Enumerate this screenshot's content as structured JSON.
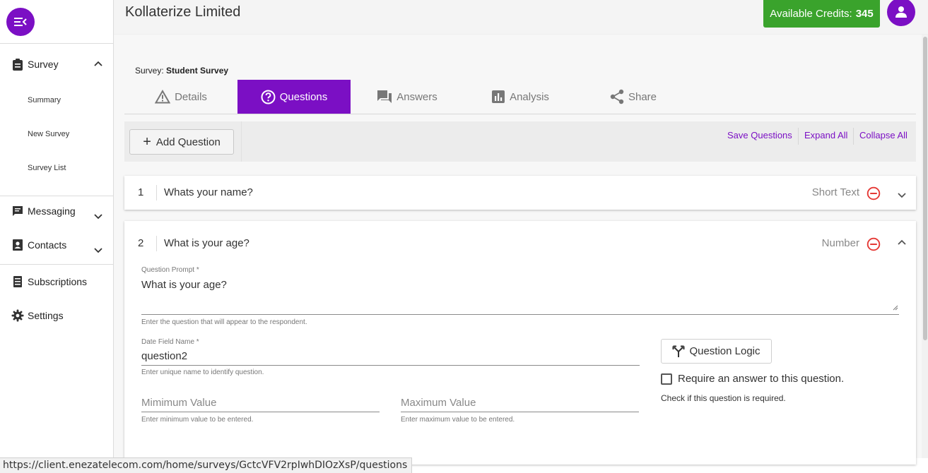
{
  "sidebar": {
    "menu_icon": "menu-collapse-icon",
    "items": [
      {
        "label": "Survey",
        "icon": "clipboard-icon",
        "expanded": true
      },
      {
        "label": "Messaging",
        "icon": "chat-icon",
        "expanded": false
      },
      {
        "label": "Contacts",
        "icon": "contacts-icon",
        "expanded": false
      },
      {
        "label": "Subscriptions",
        "icon": "list-icon"
      },
      {
        "label": "Settings",
        "icon": "gear-icon"
      }
    ],
    "survey_sub": [
      "Summary",
      "New Survey",
      "Survey List"
    ]
  },
  "header": {
    "company": "Kollaterize Limited",
    "credits_label": "Available Credits:",
    "credits_value": "345"
  },
  "survey": {
    "prefix": "Survey:",
    "name": "Student Survey"
  },
  "tabs": [
    {
      "label": "Details",
      "icon": "warning-triangle-icon",
      "active": false
    },
    {
      "label": "Questions",
      "icon": "question-circle-icon",
      "active": true
    },
    {
      "label": "Answers",
      "icon": "forum-icon",
      "active": false
    },
    {
      "label": "Analysis",
      "icon": "bar-chart-icon",
      "active": false
    },
    {
      "label": "Share",
      "icon": "share-icon",
      "active": false
    }
  ],
  "toolbar": {
    "add_question": "Add Question",
    "save_questions": "Save Questions",
    "expand_all": "Expand All",
    "collapse_all": "Collapse All"
  },
  "questions": [
    {
      "number": "1",
      "title": "Whats your name?",
      "type": "Short Text",
      "expanded": false
    },
    {
      "number": "2",
      "title": "What is your age?",
      "type": "Number",
      "expanded": true,
      "prompt_label": "Question Prompt *",
      "prompt_value": "What is your age?",
      "prompt_help": "Enter the question that will appear to the respondent.",
      "field_label": "Date Field Name *",
      "field_value": "question2",
      "field_help": "Enter unique name to identify question.",
      "min_placeholder": "Mimimum Value",
      "min_help": "Enter minimum value to be entered.",
      "max_placeholder": "Maximum Value",
      "max_help": "Enter maximum value to be entered.",
      "logic_button": "Question Logic",
      "require_label": "Require an answer to this question.",
      "require_help": "Check if this question is required.",
      "required": false
    }
  ],
  "status_url": "https://client.enezatelecom.com/home/surveys/GctcVFV2rpIwhDIOzXsP/questions",
  "colors": {
    "accent": "#7b0fc4",
    "credits_bg": "#3aa32c",
    "remove": "#e53935"
  }
}
